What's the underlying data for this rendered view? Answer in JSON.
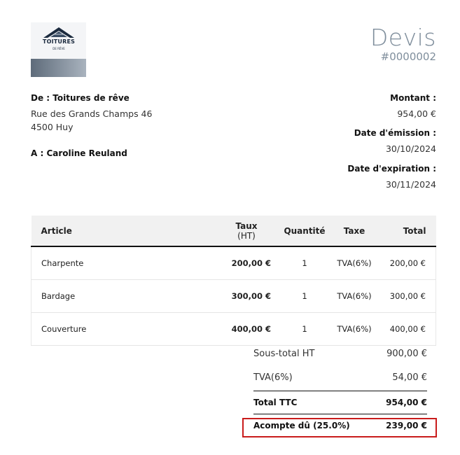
{
  "header": {
    "logo": {
      "brand_text": "TOITURES",
      "sub_text": "DE RÊVE"
    },
    "title": "Devis",
    "number": "#0000002"
  },
  "from": {
    "label": "De : Toitures de rêve",
    "address_line1": "Rue des Grands Champs 46",
    "address_line2": "4500 Huy"
  },
  "to": {
    "label": "A : Caroline Reuland"
  },
  "meta": {
    "amount_label": "Montant :",
    "amount_value": "954,00 €",
    "issue_label": "Date d'émission :",
    "issue_value": "30/10/2024",
    "expiry_label": "Date d'expiration :",
    "expiry_value": "30/11/2024"
  },
  "table": {
    "headers": {
      "article": "Article",
      "rate_line1": "Taux",
      "rate_line2": "(HT)",
      "quantity": "Quantité",
      "tax": "Taxe",
      "total": "Total"
    },
    "rows": [
      {
        "article": "Charpente",
        "rate": "200,00 €",
        "quantity": "1",
        "tax": "TVA(6%)",
        "total": "200,00 €"
      },
      {
        "article": "Bardage",
        "rate": "300,00 €",
        "quantity": "1",
        "tax": "TVA(6%)",
        "total": "300,00 €"
      },
      {
        "article": "Couverture",
        "rate": "400,00 €",
        "quantity": "1",
        "tax": "TVA(6%)",
        "total": "400,00 €"
      }
    ]
  },
  "summary": {
    "subtotal_label": "Sous-total HT",
    "subtotal_value": "900,00 €",
    "tax_label": "TVA(6%)",
    "tax_value": "54,00 €",
    "total_label": "Total TTC",
    "total_value": "954,00 €",
    "deposit_label": "Acompte dû (25.0%)",
    "deposit_value": "239,00 €"
  },
  "colors": {
    "title": "#7f8e9c",
    "highlight_border": "#c91c1c",
    "logo_navy": "#1b2a3e"
  }
}
